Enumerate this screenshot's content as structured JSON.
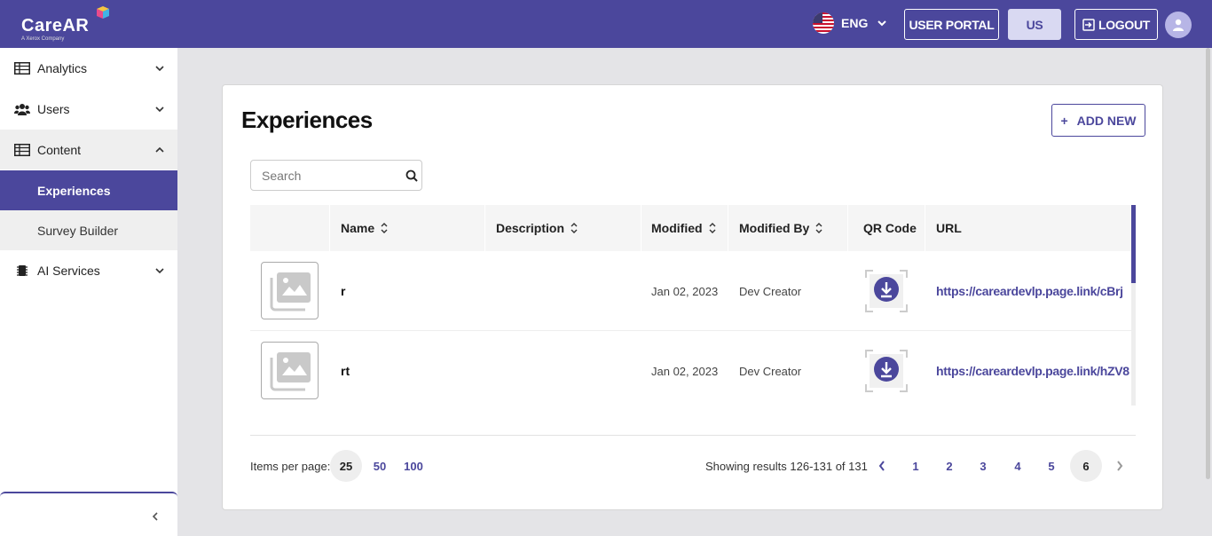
{
  "brand": {
    "name": "CareAR",
    "tagline": "A Xerox Company"
  },
  "header": {
    "language": "ENG",
    "user_portal_label": "USER PORTAL",
    "region_label": "US",
    "logout_label": "LOGOUT",
    "accent_color": "#4b479c"
  },
  "sidebar": {
    "items": [
      {
        "label": "Analytics",
        "icon": "table-icon",
        "expanded": false
      },
      {
        "label": "Users",
        "icon": "users-icon",
        "expanded": false
      },
      {
        "label": "Content",
        "icon": "table-icon",
        "expanded": true,
        "children": [
          {
            "label": "Experiences",
            "active": true
          },
          {
            "label": "Survey Builder",
            "active": false
          }
        ]
      },
      {
        "label": "AI Services",
        "icon": "chip-icon",
        "expanded": false
      }
    ]
  },
  "main": {
    "title": "Experiences",
    "add_new_label": "ADD NEW",
    "search_placeholder": "Search",
    "columns": [
      "Name",
      "Description",
      "Modified",
      "Modified By",
      "QR Code",
      "URL"
    ],
    "rows": [
      {
        "name": "r",
        "description": "",
        "modified": "Jan 02, 2023",
        "modified_by": "Dev Creator",
        "url": "https://careardevlp.page.link/cBrj"
      },
      {
        "name": "rt",
        "description": "",
        "modified": "Jan 02, 2023",
        "modified_by": "Dev Creator",
        "url": "https://careardevlp.page.link/hZV8"
      }
    ],
    "pagination": {
      "items_per_page_label": "Items per page:",
      "per_page_options": [
        "25",
        "50",
        "100"
      ],
      "per_page_selected": "25",
      "showing": "Showing results 126-131 of 131",
      "pages": [
        "1",
        "2",
        "3",
        "4",
        "5",
        "6"
      ],
      "current_page": "6"
    }
  }
}
